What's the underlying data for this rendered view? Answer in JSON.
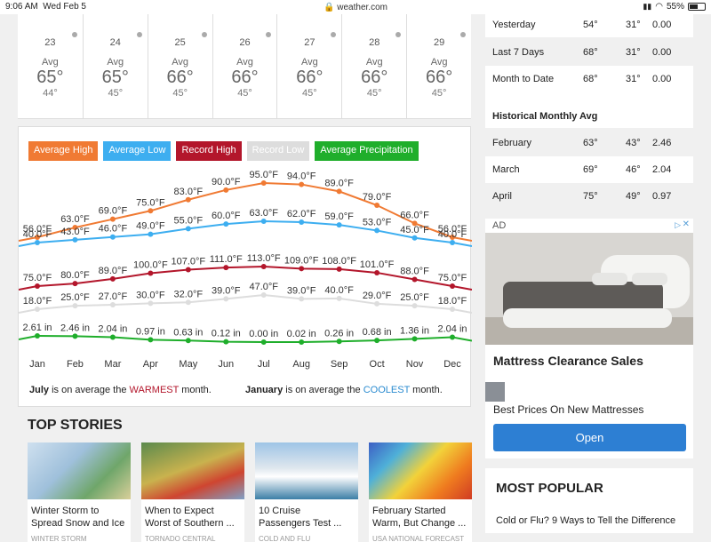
{
  "status": {
    "time": "9:06 AM",
    "date": "Wed Feb 5",
    "url": "weather.com",
    "battery": "55%",
    "battery_level": 0.55
  },
  "daily": [
    {
      "num": "23",
      "label": "Avg",
      "avg": "65°",
      "low": "44°"
    },
    {
      "num": "24",
      "label": "Avg",
      "avg": "65°",
      "low": "45°"
    },
    {
      "num": "25",
      "label": "Avg",
      "avg": "66°",
      "low": "45°"
    },
    {
      "num": "26",
      "label": "Avg",
      "avg": "66°",
      "low": "45°"
    },
    {
      "num": "27",
      "label": "Avg",
      "avg": "66°",
      "low": "45°"
    },
    {
      "num": "28",
      "label": "Avg",
      "avg": "66°",
      "low": "45°"
    },
    {
      "num": "29",
      "label": "Avg",
      "avg": "66°",
      "low": "45°"
    }
  ],
  "legend": [
    {
      "label": "Average High",
      "color": "#f07a33"
    },
    {
      "label": "Average Low",
      "color": "#3daef0"
    },
    {
      "label": "Record High",
      "color": "#b3162b"
    },
    {
      "label": "Record Low",
      "color": "#dddddd"
    },
    {
      "label": "Average Precipitation",
      "color": "#1fae2b"
    }
  ],
  "chart_data": {
    "type": "line",
    "categories": [
      "Jan",
      "Feb",
      "Mar",
      "Apr",
      "May",
      "Jun",
      "Jul",
      "Aug",
      "Sep",
      "Oct",
      "Nov",
      "Dec"
    ],
    "series": [
      {
        "name": "Average High",
        "color": "#f07a33",
        "values": [
          56,
          63,
          69,
          75,
          83,
          90,
          95,
          94,
          89,
          79,
          66,
          56
        ],
        "labels": [
          "56.0°F",
          "63.0°F",
          "69.0°F",
          "75.0°F",
          "83.0°F",
          "90.0°F",
          "95.0°F",
          "94.0°F",
          "89.0°F",
          "79.0°F",
          "66.0°F",
          "56.0°F"
        ]
      },
      {
        "name": "Average Low",
        "color": "#3daef0",
        "values": [
          40,
          43,
          46,
          49,
          55,
          60,
          63,
          62,
          59,
          53,
          45,
          40
        ],
        "labels": [
          "40.0°F",
          "43.0°F",
          "46.0°F",
          "49.0°F",
          "55.0°F",
          "60.0°F",
          "63.0°F",
          "62.0°F",
          "59.0°F",
          "53.0°F",
          "45.0°F",
          "40.0°F"
        ]
      },
      {
        "name": "Record High",
        "color": "#b3162b",
        "values": [
          75,
          80,
          89,
          100,
          107,
          111,
          113,
          109,
          108,
          101,
          88,
          75
        ],
        "labels": [
          "75.0°F",
          "80.0°F",
          "89.0°F",
          "100.0°F",
          "107.0°F",
          "111.0°F",
          "113.0°F",
          "109.0°F",
          "108.0°F",
          "101.0°F",
          "88.0°F",
          "75.0°F"
        ]
      },
      {
        "name": "Record Low",
        "color": "#dddddd",
        "values": [
          18,
          25,
          27,
          30,
          32,
          39,
          47,
          39,
          40,
          29,
          25,
          18
        ],
        "labels": [
          "18.0°F",
          "25.0°F",
          "27.0°F",
          "30.0°F",
          "32.0°F",
          "39.0°F",
          "47.0°F",
          "39.0°F",
          "40.0°F",
          "29.0°F",
          "25.0°F",
          "18.0°F"
        ]
      },
      {
        "name": "Average Precipitation",
        "color": "#1fae2b",
        "values": [
          2.61,
          2.46,
          2.04,
          0.97,
          0.63,
          0.12,
          0.0,
          0.02,
          0.26,
          0.68,
          1.36,
          2.04
        ],
        "labels": [
          "2.61 in",
          "2.46 in",
          "2.04 in",
          "0.97 in",
          "0.63 in",
          "0.12 in",
          "0.00 in",
          "0.02 in",
          "0.26 in",
          "0.68 in",
          "1.36 in",
          "2.04 in"
        ]
      }
    ]
  },
  "notes": {
    "warm_month": "July",
    "warm_pre": " is on average the ",
    "warm_word": "WARMEST",
    "warm_post": " month.",
    "cool_month": "January",
    "cool_pre": " is on average the ",
    "cool_word": "COOLEST",
    "cool_post": " month."
  },
  "top_stories": {
    "heading": "TOP STORIES",
    "items": [
      {
        "title": "Winter Storm to Spread Snow and Ice",
        "sub": "WINTER STORM"
      },
      {
        "title": "When to Expect Worst of Southern ...",
        "sub": "TORNADO CENTRAL"
      },
      {
        "title": "10 Cruise Passengers Test ...",
        "sub": "COLD AND FLU"
      },
      {
        "title": "February Started Warm, But Change ...",
        "sub": "USA NATIONAL FORECAST"
      }
    ]
  },
  "sidebar": {
    "recent": [
      {
        "label": "Yesterday",
        "high": "54°",
        "low": "31°",
        "precip": "0.00"
      },
      {
        "label": "Last 7 Days",
        "high": "68°",
        "low": "31°",
        "precip": "0.00"
      },
      {
        "label": "Month to Date",
        "high": "68°",
        "low": "31°",
        "precip": "0.00"
      }
    ],
    "hist_title": "Historical Monthly Avg",
    "hist": [
      {
        "label": "February",
        "high": "63°",
        "low": "43°",
        "precip": "2.46"
      },
      {
        "label": "March",
        "high": "69°",
        "low": "46°",
        "precip": "2.04"
      },
      {
        "label": "April",
        "high": "75°",
        "low": "49°",
        "precip": "0.97"
      }
    ]
  },
  "ad": {
    "tag": "AD",
    "title": "Mattress Clearance Sales",
    "subtitle": "Best Prices On New Mattresses",
    "button": "Open"
  },
  "most_popular": {
    "heading": "MOST POPULAR",
    "item": "Cold or Flu? 9 Ways to Tell the Difference"
  }
}
